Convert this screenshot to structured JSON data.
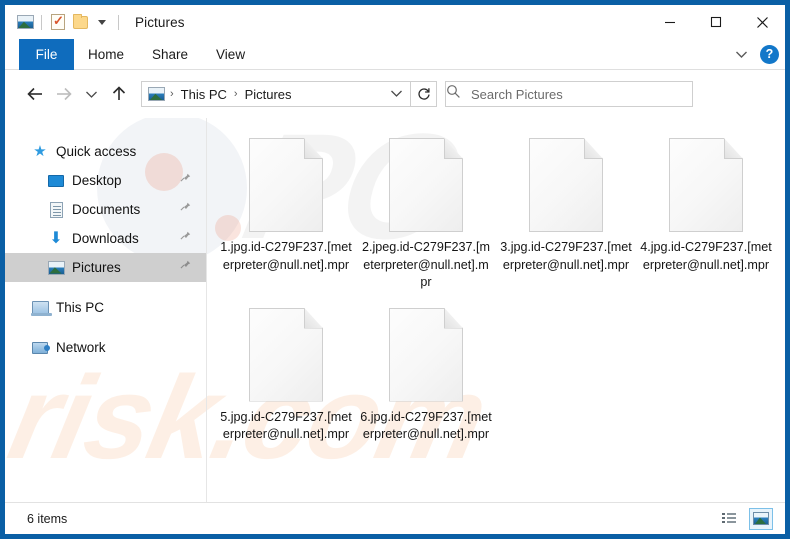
{
  "window": {
    "title": "Pictures",
    "frame_color": "#0a5fa5"
  },
  "quick_access_toolbar": {
    "items": [
      {
        "name": "pictures-folder-icon",
        "label": "Pictures"
      },
      {
        "name": "properties-icon",
        "label": "Properties"
      },
      {
        "name": "new-folder-icon",
        "label": "New folder"
      },
      {
        "name": "customize-dropdown",
        "label": "Customize Quick Access Toolbar"
      }
    ]
  },
  "window_controls": {
    "minimize": "Minimize",
    "maximize": "Maximize",
    "close": "Close"
  },
  "ribbon": {
    "tabs": [
      {
        "label": "File",
        "active": true
      },
      {
        "label": "Home",
        "active": false
      },
      {
        "label": "Share",
        "active": false
      },
      {
        "label": "View",
        "active": false
      }
    ],
    "expand_label": "Expand the Ribbon",
    "help_label": "?",
    "accent_color": "#0f6cbd"
  },
  "navigation": {
    "back_label": "Back",
    "forward_label": "Forward",
    "recent_label": "Recent locations",
    "up_label": "Up",
    "refresh_label": "Refresh"
  },
  "address_bar": {
    "breadcrumbs": [
      "This PC",
      "Pictures"
    ],
    "separator": "›",
    "dropdown_label": "Previous locations"
  },
  "search": {
    "placeholder": "Search Pictures",
    "value": ""
  },
  "sidebar": {
    "items": [
      {
        "label": "Quick access",
        "icon": "star-icon",
        "indent": false,
        "selected": false,
        "pinned": false
      },
      {
        "label": "Desktop",
        "icon": "desktop-icon",
        "indent": true,
        "selected": false,
        "pinned": true
      },
      {
        "label": "Documents",
        "icon": "documents-icon",
        "indent": true,
        "selected": false,
        "pinned": true
      },
      {
        "label": "Downloads",
        "icon": "downloads-icon",
        "indent": true,
        "selected": false,
        "pinned": true
      },
      {
        "label": "Pictures",
        "icon": "pictures-icon",
        "indent": true,
        "selected": true,
        "pinned": true
      },
      {
        "label": "This PC",
        "icon": "this-pc-icon",
        "indent": false,
        "selected": false,
        "pinned": false
      },
      {
        "label": "Network",
        "icon": "network-icon",
        "indent": false,
        "selected": false,
        "pinned": false
      }
    ]
  },
  "files": [
    {
      "name": "1.jpg.id-C279F237.[meterpreter@null.net].mpr",
      "icon": "blank-file-icon"
    },
    {
      "name": "2.jpeg.id-C279F237.[meterpreter@null.net].mpr",
      "icon": "blank-file-icon"
    },
    {
      "name": "3.jpg.id-C279F237.[meterpreter@null.net].mpr",
      "icon": "blank-file-icon"
    },
    {
      "name": "4.jpg.id-C279F237.[meterpreter@null.net].mpr",
      "icon": "blank-file-icon"
    },
    {
      "name": "5.jpg.id-C279F237.[meterpreter@null.net].mpr",
      "icon": "blank-file-icon"
    },
    {
      "name": "6.jpg.id-C279F237.[meterpreter@null.net].mpr",
      "icon": "blank-file-icon"
    }
  ],
  "status_bar": {
    "item_count": "6 items",
    "views": [
      {
        "name": "details-view-button",
        "label": "Details view",
        "active": false
      },
      {
        "name": "large-icons-view-button",
        "label": "Large icons view",
        "active": true
      }
    ]
  },
  "watermark": {
    "top": "PC",
    "bottom": "risk.com"
  }
}
